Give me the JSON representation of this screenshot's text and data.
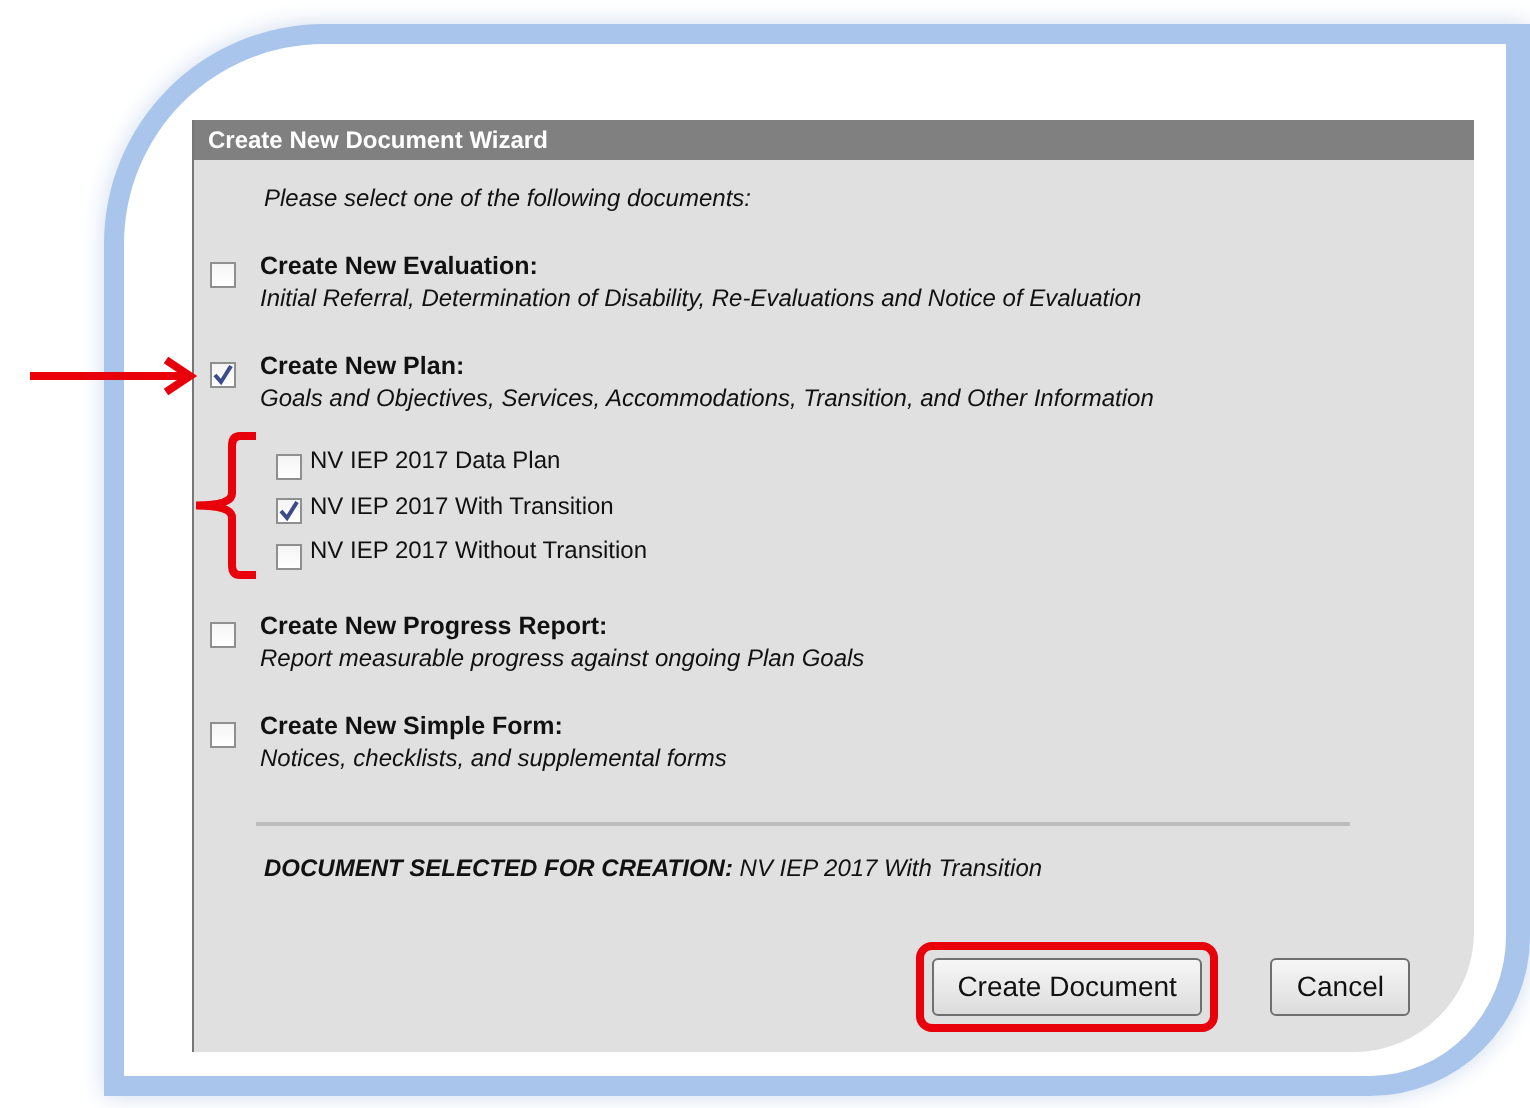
{
  "dialog": {
    "title": "Create New Document Wizard",
    "instruction": "Please select one of the following documents:",
    "options": [
      {
        "title": "Create New Evaluation:",
        "description": "Initial Referral, Determination of Disability, Re-Evaluations and Notice of Evaluation",
        "checked": false,
        "pointed": false
      },
      {
        "title": "Create New Plan:",
        "description": "Goals and Objectives, Services, Accommodations, Transition, and Other Information",
        "checked": true,
        "pointed": true,
        "children": [
          {
            "label": "NV IEP 2017 Data Plan",
            "checked": false
          },
          {
            "label": "NV IEP 2017 With Transition",
            "checked": true
          },
          {
            "label": "NV IEP 2017 Without Transition",
            "checked": false
          }
        ]
      },
      {
        "title": "Create New Progress Report:",
        "description": "Report measurable progress against ongoing Plan Goals",
        "checked": false,
        "pointed": false
      },
      {
        "title": "Create New Simple Form:",
        "description": "Notices, checklists, and supplemental forms",
        "checked": false,
        "pointed": false
      }
    ],
    "summary": {
      "label": "DOCUMENT SELECTED FOR CREATION:",
      "value": "NV IEP 2017 With Transition"
    },
    "buttons": [
      {
        "label": "Create Document",
        "highlighted": true
      },
      {
        "label": "Cancel",
        "highlighted": false
      }
    ]
  }
}
